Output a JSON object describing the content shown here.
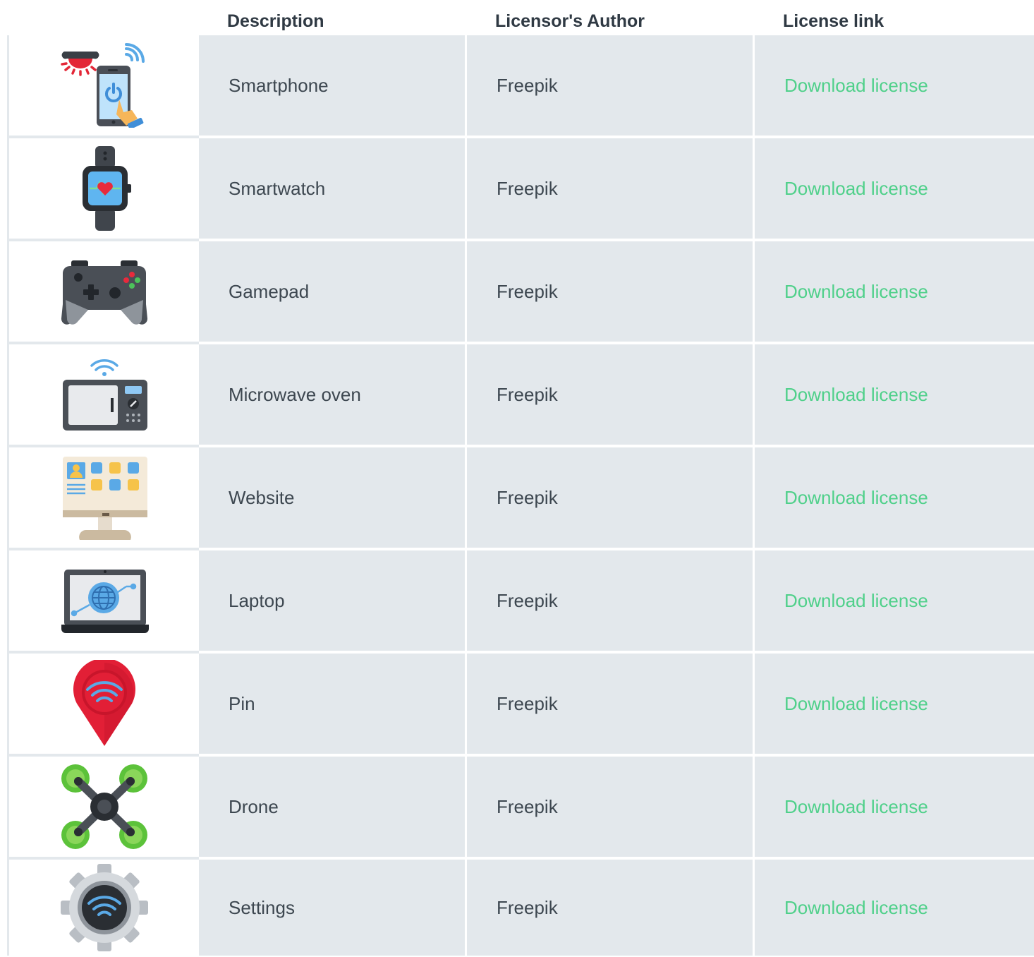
{
  "headers": {
    "description": "Description",
    "author": "Licensor's Author",
    "license": "License link"
  },
  "rows": [
    {
      "icon": "smartphone-icon",
      "description": "Smartphone",
      "author": "Freepik",
      "license": "Download license"
    },
    {
      "icon": "smartwatch-icon",
      "description": "Smartwatch",
      "author": "Freepik",
      "license": "Download license"
    },
    {
      "icon": "gamepad-icon",
      "description": "Gamepad",
      "author": "Freepik",
      "license": "Download license"
    },
    {
      "icon": "microwave-oven-icon",
      "description": "Microwave oven",
      "author": "Freepik",
      "license": "Download license"
    },
    {
      "icon": "website-icon",
      "description": "Website",
      "author": "Freepik",
      "license": "Download license"
    },
    {
      "icon": "laptop-icon",
      "description": "Laptop",
      "author": "Freepik",
      "license": "Download license"
    },
    {
      "icon": "pin-icon",
      "description": "Pin",
      "author": "Freepik",
      "license": "Download license"
    },
    {
      "icon": "drone-icon",
      "description": "Drone",
      "author": "Freepik",
      "license": "Download license"
    },
    {
      "icon": "settings-icon",
      "description": "Settings",
      "author": "Freepik",
      "license": "Download license"
    }
  ],
  "colors": {
    "row_background": "#e3e8ec",
    "header_text": "#2f3943",
    "body_text": "#3d4750",
    "link": "#4fd08a"
  }
}
